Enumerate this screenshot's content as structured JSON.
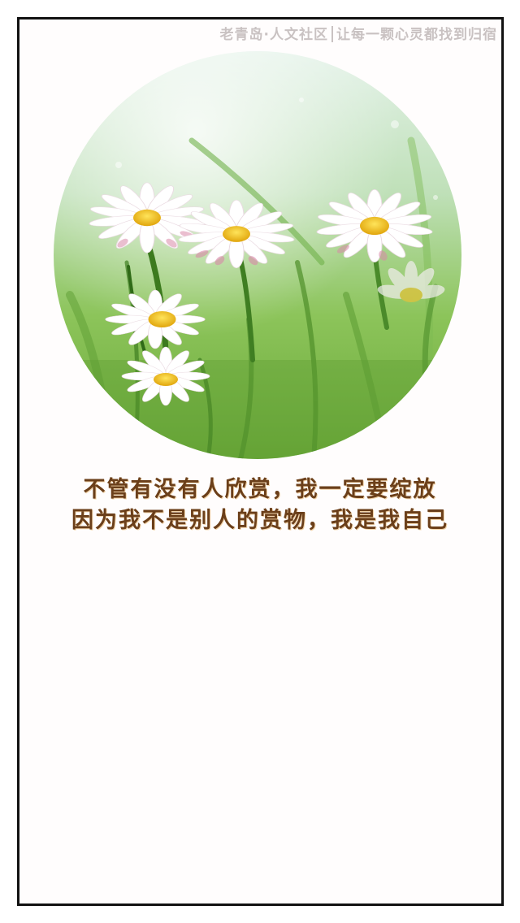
{
  "watermark": {
    "community": "老青岛·人文社区",
    "slogan": "让每一颗心灵都找到归宿"
  },
  "photo": {
    "subject": "daisy-flowers-in-grass",
    "colors": {
      "sky": "#d9ede0",
      "grass_light": "#9fcf6a",
      "grass_dark": "#4f8f2a",
      "petal": "#ffffff",
      "petal_tint": "#d98aa8",
      "center": "#f2c21c"
    }
  },
  "quote": {
    "line1": "不管有没有人欣赏，我一定要绽放",
    "line2": "因为我不是别人的赏物，我是我自己",
    "color": "#6b3f1a"
  }
}
